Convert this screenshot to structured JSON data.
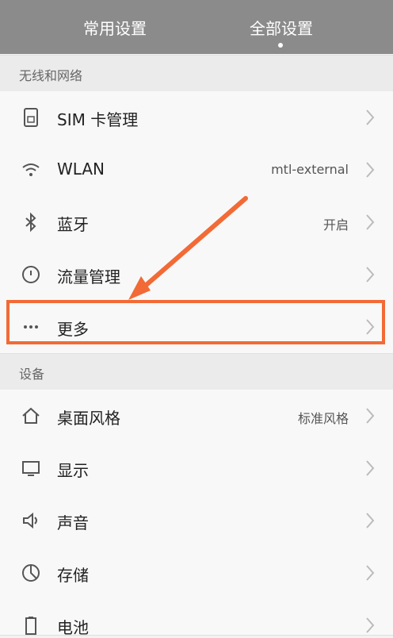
{
  "header": {
    "tabs": [
      {
        "label": "常用设置"
      },
      {
        "label": "全部设置"
      }
    ]
  },
  "sections": {
    "wireless": "无线和网络",
    "device": "设备"
  },
  "rows": [
    {
      "label": "SIM 卡管理",
      "value": "",
      "icon": "sim-card-icon"
    },
    {
      "label": "WLAN",
      "value": "mtl-external",
      "icon": "wifi-icon"
    },
    {
      "label": "蓝牙",
      "value": "开启",
      "icon": "bluetooth-icon"
    },
    {
      "label": "流量管理",
      "value": "",
      "icon": "data-usage-icon"
    },
    {
      "label": "更多",
      "value": "",
      "icon": "more-icon"
    },
    {
      "label": "桌面风格",
      "value": "标准风格",
      "icon": "home-icon"
    },
    {
      "label": "显示",
      "value": "",
      "icon": "display-icon"
    },
    {
      "label": "声音",
      "value": "",
      "icon": "speaker-icon"
    },
    {
      "label": "存储",
      "value": "",
      "icon": "storage-icon"
    },
    {
      "label": "电池",
      "value": "",
      "icon": "battery-icon"
    }
  ],
  "accent_color": "#f26a36"
}
